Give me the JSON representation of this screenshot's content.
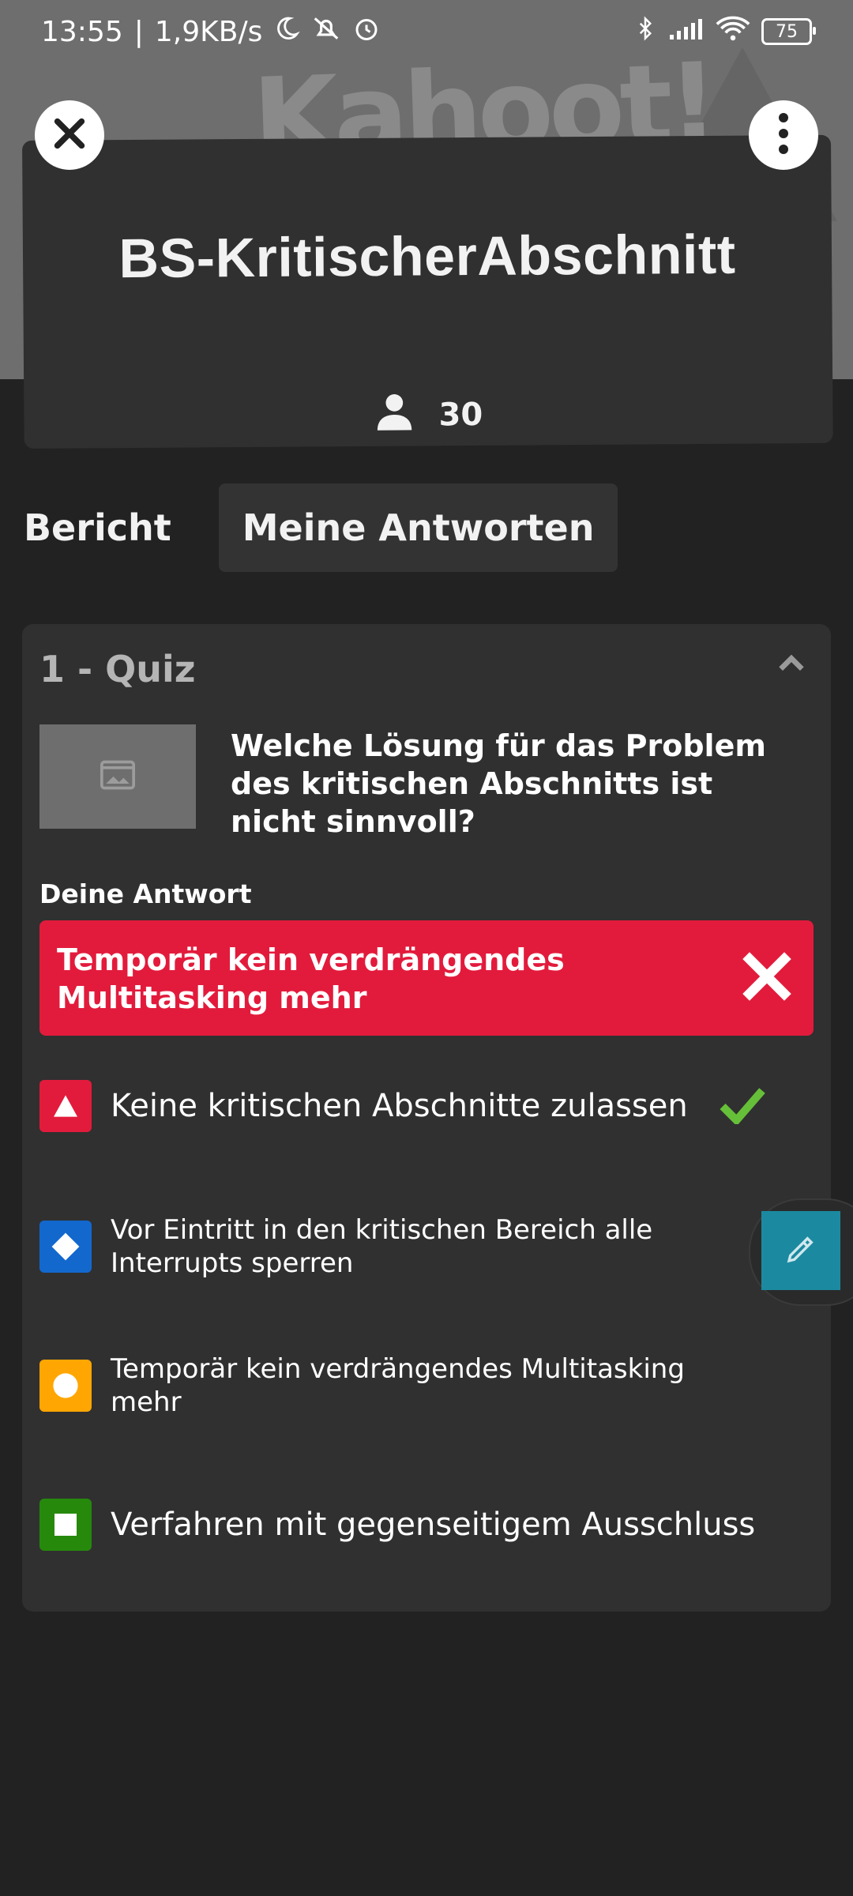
{
  "status": {
    "time": "13:55",
    "separator": "|",
    "speed": "1,9KB/s",
    "battery": "75"
  },
  "header": {
    "logo": "Kahoot!",
    "title": "BS-KritischerAbschnitt",
    "players": "30"
  },
  "tabs": [
    {
      "label": "Bericht"
    },
    {
      "label": "Meine Antworten",
      "active": true
    }
  ],
  "quiz": {
    "title": "1 - Quiz",
    "question": "Welche Lösung für das Problem des kritischen Abschnitts ist nicht sinnvoll?",
    "your_answer_label": "Deine Antwort",
    "your_answer": "Temporär kein verdrängendes Multitasking mehr",
    "your_answer_correct": false,
    "options": [
      {
        "shape": "triangle",
        "color": "#e21b3c",
        "text": "Keine kritischen Abschnitte zulassen",
        "correct": true
      },
      {
        "shape": "diamond",
        "color": "#1368ce",
        "text": "Vor Eintritt in den kritischen Bereich alle Interrupts sperren",
        "correct": false
      },
      {
        "shape": "circle",
        "color": "#ffa602",
        "text": "Temporär kein verdrängendes Multitasking mehr",
        "correct": false
      },
      {
        "shape": "square",
        "color": "#26890c",
        "text": "Verfahren mit gegenseitigem Ausschluss",
        "correct": false
      }
    ]
  },
  "icons": {
    "close": "close-icon",
    "more": "more-vertical-icon",
    "player": "person-icon",
    "collapse": "chevron-up-icon",
    "image_placeholder": "image-icon",
    "wrong": "x-icon",
    "correct": "checkmark-icon",
    "edit": "pencil-icon"
  },
  "colors": {
    "background": "#222222",
    "card": "#303030",
    "wrong_answer": "#e21b3c",
    "correct_check": "#66bf39",
    "edit_button": "#1b8aa0"
  }
}
